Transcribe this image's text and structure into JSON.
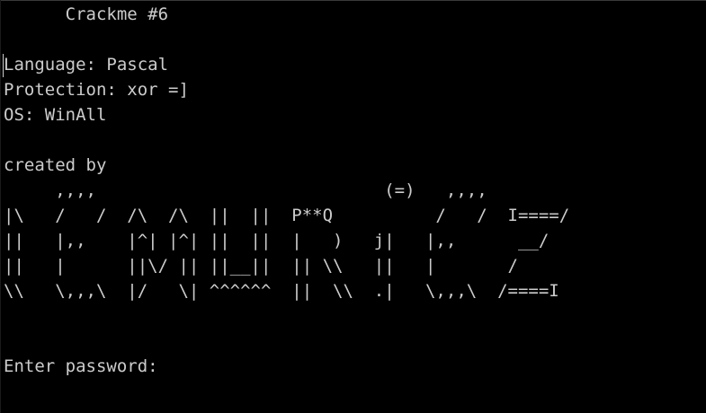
{
  "window": {
    "background": "#000000",
    "foreground": "#cccccc"
  },
  "console": {
    "lines": [
      "      Crackme #6",
      "",
      "Language: Pascal",
      "Protection: xor =]",
      "OS: WinAll",
      "",
      "created by",
      "     ,,,,                            (=)   ,,,,",
      "|\\   /   /  /\\  /\\  ||  ||  P**Q          /   /  I====/",
      "||   |,,    |^| |^| ||  ||  |   )   j|   |,,      __/",
      "||   |      ||\\/ || ||__||  || \\\\   ||   |       /",
      "\\\\   \\,,,\\  |/   \\| ^^^^^^  ||  \\\\  .|   \\,,,\\  /====I",
      "",
      "",
      "Enter password: "
    ]
  }
}
